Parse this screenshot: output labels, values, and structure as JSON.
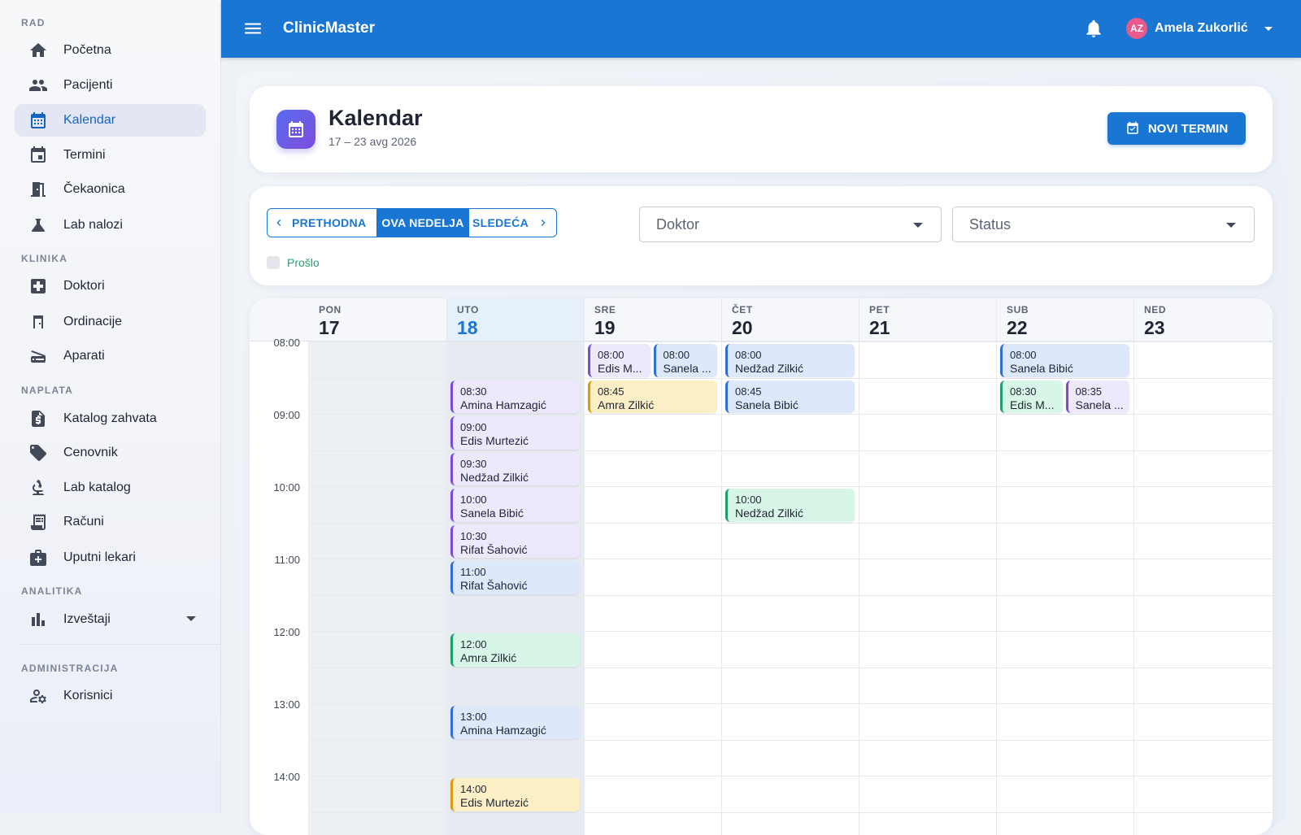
{
  "sidebar": {
    "sections": [
      {
        "label": "RAD",
        "items": [
          {
            "label": "Početna",
            "icon": "home-icon"
          },
          {
            "label": "Pacijenti",
            "icon": "people-icon"
          },
          {
            "label": "Kalendar",
            "icon": "calendar-icon",
            "active": true
          },
          {
            "label": "Termini",
            "icon": "event-icon"
          },
          {
            "label": "Čekaonica",
            "icon": "door-icon"
          },
          {
            "label": "Lab nalozi",
            "icon": "flask-icon"
          }
        ]
      },
      {
        "label": "KLINIKA",
        "items": [
          {
            "label": "Doktori",
            "icon": "medical-cross-icon"
          },
          {
            "label": "Ordinacije",
            "icon": "room-icon"
          },
          {
            "label": "Aparati",
            "icon": "scanner-icon"
          }
        ]
      },
      {
        "label": "NAPLATA",
        "items": [
          {
            "label": "Katalog zahvata",
            "icon": "price-doc-icon"
          },
          {
            "label": "Cenovnik",
            "icon": "tag-icon"
          },
          {
            "label": "Lab katalog",
            "icon": "microscope-icon"
          },
          {
            "label": "Računi",
            "icon": "receipt-icon"
          },
          {
            "label": "Uputni lekari",
            "icon": "medical-bag-icon"
          }
        ]
      },
      {
        "label": "ANALITIKA",
        "items": [
          {
            "label": "Izveštaji",
            "icon": "bar-chart-icon",
            "expandable": true
          }
        ]
      },
      {
        "label": "ADMINISTRACIJA",
        "items": [
          {
            "label": "Korisnici",
            "icon": "user-settings-icon"
          }
        ]
      }
    ]
  },
  "appbar": {
    "title": "ClinicMaster",
    "user_initials": "AZ",
    "user_name": "Amela Zukorlić"
  },
  "header": {
    "title": "Kalendar",
    "subtitle": "17 – 23 avg 2026",
    "new_button": "NOVI TERMIN"
  },
  "filters": {
    "prev": "PRETHODNA",
    "current": "OVA NEDELJA",
    "next": "SLEDEĆA",
    "doctor_placeholder": "Doktor",
    "status_placeholder": "Status",
    "past_label": "Prošlo"
  },
  "calendar": {
    "days": [
      {
        "dow": "PON",
        "num": "17"
      },
      {
        "dow": "UTO",
        "num": "18",
        "today": true
      },
      {
        "dow": "SRE",
        "num": "19"
      },
      {
        "dow": "ČET",
        "num": "20"
      },
      {
        "dow": "PET",
        "num": "21"
      },
      {
        "dow": "SUB",
        "num": "22"
      },
      {
        "dow": "NED",
        "num": "23"
      }
    ],
    "hours": [
      "08:00",
      "09:00",
      "10:00",
      "11:00",
      "12:00",
      "13:00",
      "14:00"
    ],
    "colors": {
      "purple": "#7b4cd6",
      "blue": "#2f6fd6",
      "yellow": "#dd9a0f",
      "green": "#1e9e6a"
    },
    "events": [
      {
        "day": 1,
        "time": "08:30",
        "name": "Amina Hamzagić",
        "color": "purple"
      },
      {
        "day": 1,
        "time": "09:00",
        "name": "Edis Murtezić",
        "color": "purple"
      },
      {
        "day": 1,
        "time": "09:30",
        "name": "Nedžad Zilkić",
        "color": "purple"
      },
      {
        "day": 1,
        "time": "10:00",
        "name": "Sanela Bibić",
        "color": "purple"
      },
      {
        "day": 1,
        "time": "10:30",
        "name": "Rifat Šahović",
        "color": "purple"
      },
      {
        "day": 1,
        "time": "11:00",
        "name": "Rifat Šahović",
        "color": "blue"
      },
      {
        "day": 1,
        "time": "12:00",
        "name": "Amra Zilkić",
        "color": "green"
      },
      {
        "day": 1,
        "time": "13:00",
        "name": "Amina Hamzagić",
        "color": "blue"
      },
      {
        "day": 1,
        "time": "14:00",
        "name": "Edis Murtezić",
        "color": "yellow"
      },
      {
        "day": 2,
        "time": "08:00",
        "name": "Edis M...",
        "color": "purple",
        "half": 0
      },
      {
        "day": 2,
        "time": "08:00",
        "name": "Sanela ...",
        "color": "blue",
        "half": 1
      },
      {
        "day": 2,
        "time": "08:45",
        "name": "Amra Zilkić",
        "color": "yellow"
      },
      {
        "day": 3,
        "time": "08:00",
        "name": "Nedžad Zilkić",
        "color": "blue"
      },
      {
        "day": 3,
        "time": "08:45",
        "name": "Sanela Bibić",
        "color": "blue"
      },
      {
        "day": 3,
        "time": "10:00",
        "name": "Nedžad Zilkić",
        "color": "green"
      },
      {
        "day": 5,
        "time": "08:00",
        "name": "Sanela Bibić",
        "color": "blue"
      },
      {
        "day": 5,
        "time": "08:30",
        "name": "Edis M...",
        "color": "green",
        "half": 0
      },
      {
        "day": 5,
        "time": "08:35",
        "name": "Sanela ...",
        "color": "purple",
        "half": 1
      }
    ]
  }
}
